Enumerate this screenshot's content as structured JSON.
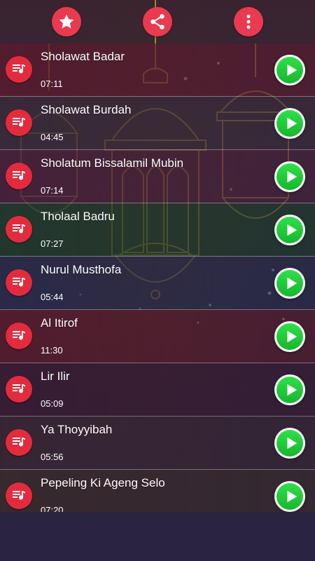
{
  "toolbar": {
    "favorite_icon": "star-icon",
    "share_icon": "share-icon",
    "more_icon": "more-vertical-icon"
  },
  "colors": {
    "accent_red": "#ea3a4f",
    "play_green": "#1fc83a",
    "row_tints": [
      "#5a1a2e",
      "#3a2a3a",
      "#4a1f3a",
      "#1f3a2a",
      "#2a2a4a",
      "#5a1a2a",
      "#3a1a30",
      "#3a2530",
      "#3a2a28"
    ]
  },
  "tracks": [
    {
      "title": "Sholawat Badar",
      "duration": "07:11"
    },
    {
      "title": "Sholawat Burdah",
      "duration": "04:45"
    },
    {
      "title": "Sholatum Bissalamil Mubin",
      "duration": "07:14"
    },
    {
      "title": "Tholaal Badru",
      "duration": "07:27"
    },
    {
      "title": "Nurul Musthofa",
      "duration": "05:44"
    },
    {
      "title": "Al Itirof",
      "duration": "11:30"
    },
    {
      "title": "Lir Ilir",
      "duration": "05:09"
    },
    {
      "title": "Ya Thoyyibah",
      "duration": "05:56"
    },
    {
      "title": "Pepeling Ki Ageng Selo",
      "duration": "07:20"
    }
  ]
}
